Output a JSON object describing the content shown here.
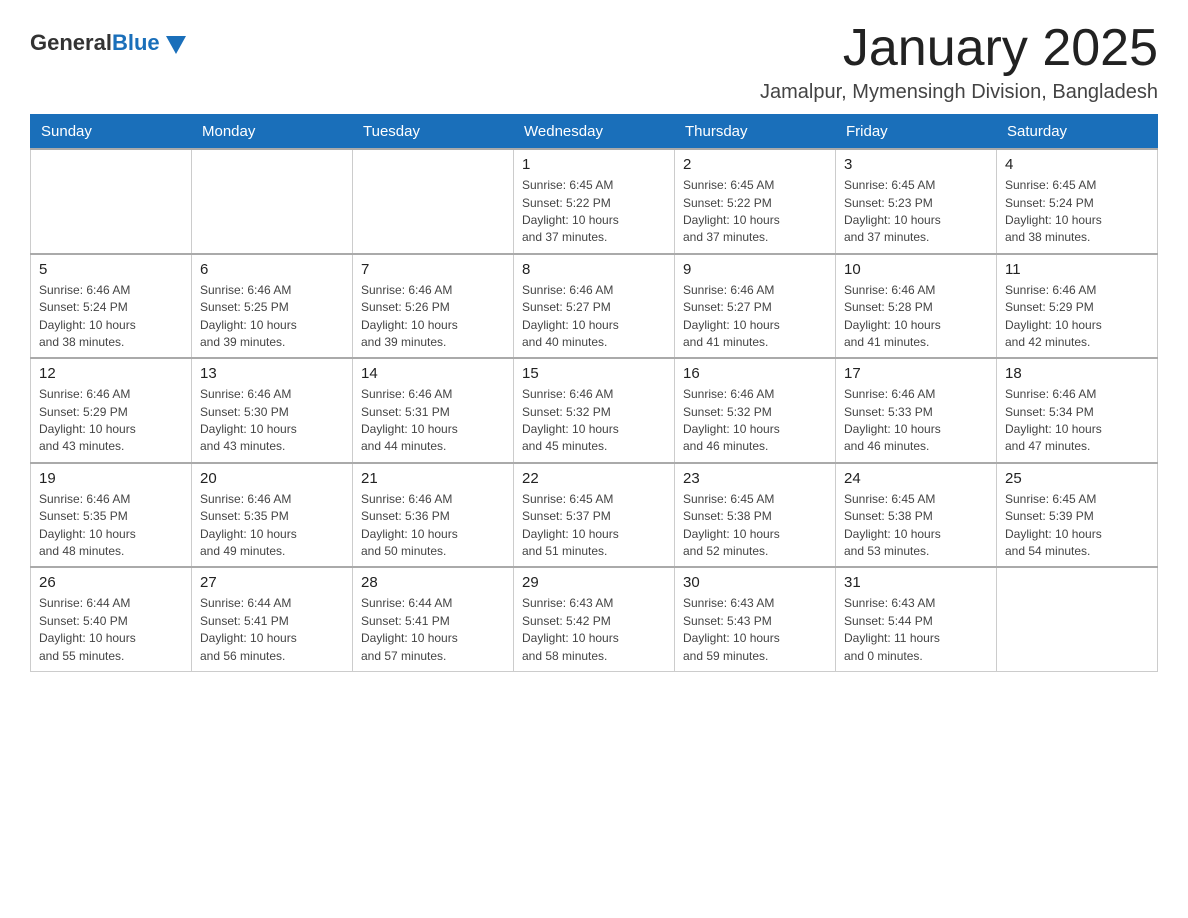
{
  "header": {
    "logo": {
      "general": "General",
      "blue": "Blue"
    },
    "title": "January 2025",
    "subtitle": "Jamalpur, Mymensingh Division, Bangladesh"
  },
  "weekdays": [
    "Sunday",
    "Monday",
    "Tuesday",
    "Wednesday",
    "Thursday",
    "Friday",
    "Saturday"
  ],
  "weeks": [
    [
      {
        "day": "",
        "info": ""
      },
      {
        "day": "",
        "info": ""
      },
      {
        "day": "",
        "info": ""
      },
      {
        "day": "1",
        "info": "Sunrise: 6:45 AM\nSunset: 5:22 PM\nDaylight: 10 hours\nand 37 minutes."
      },
      {
        "day": "2",
        "info": "Sunrise: 6:45 AM\nSunset: 5:22 PM\nDaylight: 10 hours\nand 37 minutes."
      },
      {
        "day": "3",
        "info": "Sunrise: 6:45 AM\nSunset: 5:23 PM\nDaylight: 10 hours\nand 37 minutes."
      },
      {
        "day": "4",
        "info": "Sunrise: 6:45 AM\nSunset: 5:24 PM\nDaylight: 10 hours\nand 38 minutes."
      }
    ],
    [
      {
        "day": "5",
        "info": "Sunrise: 6:46 AM\nSunset: 5:24 PM\nDaylight: 10 hours\nand 38 minutes."
      },
      {
        "day": "6",
        "info": "Sunrise: 6:46 AM\nSunset: 5:25 PM\nDaylight: 10 hours\nand 39 minutes."
      },
      {
        "day": "7",
        "info": "Sunrise: 6:46 AM\nSunset: 5:26 PM\nDaylight: 10 hours\nand 39 minutes."
      },
      {
        "day": "8",
        "info": "Sunrise: 6:46 AM\nSunset: 5:27 PM\nDaylight: 10 hours\nand 40 minutes."
      },
      {
        "day": "9",
        "info": "Sunrise: 6:46 AM\nSunset: 5:27 PM\nDaylight: 10 hours\nand 41 minutes."
      },
      {
        "day": "10",
        "info": "Sunrise: 6:46 AM\nSunset: 5:28 PM\nDaylight: 10 hours\nand 41 minutes."
      },
      {
        "day": "11",
        "info": "Sunrise: 6:46 AM\nSunset: 5:29 PM\nDaylight: 10 hours\nand 42 minutes."
      }
    ],
    [
      {
        "day": "12",
        "info": "Sunrise: 6:46 AM\nSunset: 5:29 PM\nDaylight: 10 hours\nand 43 minutes."
      },
      {
        "day": "13",
        "info": "Sunrise: 6:46 AM\nSunset: 5:30 PM\nDaylight: 10 hours\nand 43 minutes."
      },
      {
        "day": "14",
        "info": "Sunrise: 6:46 AM\nSunset: 5:31 PM\nDaylight: 10 hours\nand 44 minutes."
      },
      {
        "day": "15",
        "info": "Sunrise: 6:46 AM\nSunset: 5:32 PM\nDaylight: 10 hours\nand 45 minutes."
      },
      {
        "day": "16",
        "info": "Sunrise: 6:46 AM\nSunset: 5:32 PM\nDaylight: 10 hours\nand 46 minutes."
      },
      {
        "day": "17",
        "info": "Sunrise: 6:46 AM\nSunset: 5:33 PM\nDaylight: 10 hours\nand 46 minutes."
      },
      {
        "day": "18",
        "info": "Sunrise: 6:46 AM\nSunset: 5:34 PM\nDaylight: 10 hours\nand 47 minutes."
      }
    ],
    [
      {
        "day": "19",
        "info": "Sunrise: 6:46 AM\nSunset: 5:35 PM\nDaylight: 10 hours\nand 48 minutes."
      },
      {
        "day": "20",
        "info": "Sunrise: 6:46 AM\nSunset: 5:35 PM\nDaylight: 10 hours\nand 49 minutes."
      },
      {
        "day": "21",
        "info": "Sunrise: 6:46 AM\nSunset: 5:36 PM\nDaylight: 10 hours\nand 50 minutes."
      },
      {
        "day": "22",
        "info": "Sunrise: 6:45 AM\nSunset: 5:37 PM\nDaylight: 10 hours\nand 51 minutes."
      },
      {
        "day": "23",
        "info": "Sunrise: 6:45 AM\nSunset: 5:38 PM\nDaylight: 10 hours\nand 52 minutes."
      },
      {
        "day": "24",
        "info": "Sunrise: 6:45 AM\nSunset: 5:38 PM\nDaylight: 10 hours\nand 53 minutes."
      },
      {
        "day": "25",
        "info": "Sunrise: 6:45 AM\nSunset: 5:39 PM\nDaylight: 10 hours\nand 54 minutes."
      }
    ],
    [
      {
        "day": "26",
        "info": "Sunrise: 6:44 AM\nSunset: 5:40 PM\nDaylight: 10 hours\nand 55 minutes."
      },
      {
        "day": "27",
        "info": "Sunrise: 6:44 AM\nSunset: 5:41 PM\nDaylight: 10 hours\nand 56 minutes."
      },
      {
        "day": "28",
        "info": "Sunrise: 6:44 AM\nSunset: 5:41 PM\nDaylight: 10 hours\nand 57 minutes."
      },
      {
        "day": "29",
        "info": "Sunrise: 6:43 AM\nSunset: 5:42 PM\nDaylight: 10 hours\nand 58 minutes."
      },
      {
        "day": "30",
        "info": "Sunrise: 6:43 AM\nSunset: 5:43 PM\nDaylight: 10 hours\nand 59 minutes."
      },
      {
        "day": "31",
        "info": "Sunrise: 6:43 AM\nSunset: 5:44 PM\nDaylight: 11 hours\nand 0 minutes."
      },
      {
        "day": "",
        "info": ""
      }
    ]
  ]
}
